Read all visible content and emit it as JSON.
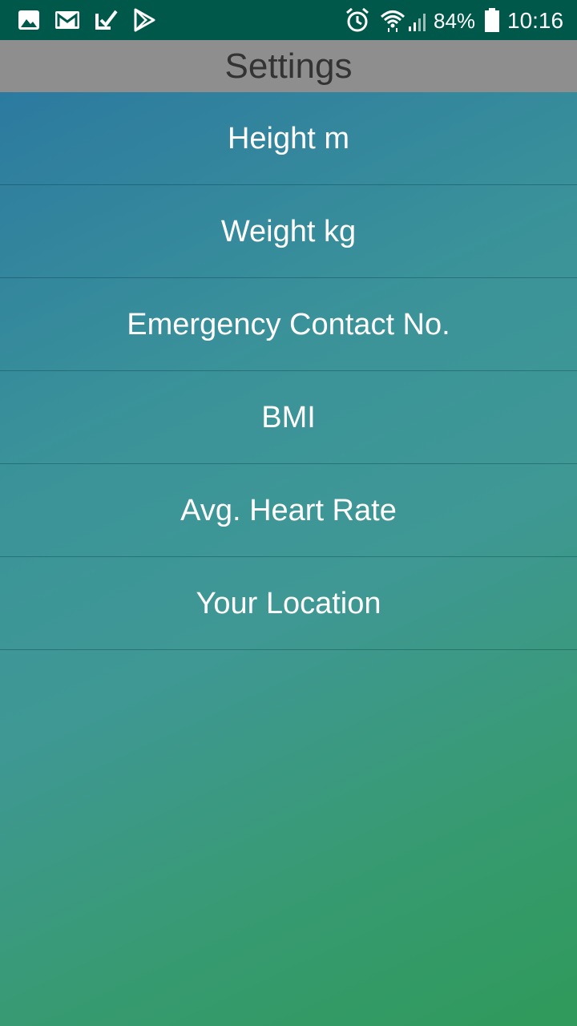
{
  "status_bar": {
    "left_icons": [
      "image-icon",
      "gmail-icon",
      "task-check-icon",
      "play-store-icon"
    ],
    "right_icons": [
      "alarm-icon",
      "wifi-icon",
      "signal-icon",
      "battery-icon"
    ],
    "battery": "84%",
    "time": "10:16",
    "background": "#00584a"
  },
  "header": {
    "title": "Settings",
    "background": "#8e8e8e",
    "text_color": "#333333"
  },
  "menu": {
    "items": [
      {
        "label": "Height m"
      },
      {
        "label": "Weight kg"
      },
      {
        "label": "Emergency Contact No."
      },
      {
        "label": "BMI"
      },
      {
        "label": "Avg. Heart Rate"
      },
      {
        "label": "Your Location"
      }
    ]
  },
  "theme": {
    "gradient_start": "#2c7aa0",
    "gradient_end": "#2f9a5a"
  }
}
